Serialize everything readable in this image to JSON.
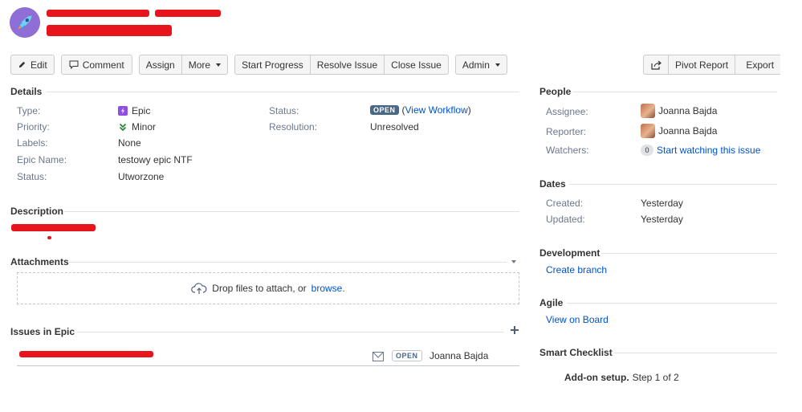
{
  "toolbar": {
    "edit": "Edit",
    "comment": "Comment",
    "assign": "Assign",
    "more": "More",
    "start_progress": "Start Progress",
    "resolve_issue": "Resolve Issue",
    "close_issue": "Close Issue",
    "admin": "Admin",
    "pivot_report": "Pivot Report",
    "export": "Export"
  },
  "details": {
    "title": "Details",
    "type_label": "Type:",
    "type_value": "Epic",
    "priority_label": "Priority:",
    "priority_value": "Minor",
    "labels_label": "Labels:",
    "labels_value": "None",
    "epic_name_label": "Epic Name:",
    "epic_name_value": "testowy epic NTF",
    "epic_status_label": "Status:",
    "epic_status_value": "Utworzone",
    "status_label": "Status:",
    "status_value": "OPEN",
    "view_workflow": "View Workflow",
    "resolution_label": "Resolution:",
    "resolution_value": "Unresolved"
  },
  "description": {
    "title": "Description"
  },
  "attachments": {
    "title": "Attachments",
    "drop_text": "Drop files to attach, or",
    "browse": "browse."
  },
  "issues_in_epic": {
    "title": "Issues in Epic",
    "rows": [
      {
        "status": "OPEN",
        "assignee": "Joanna Bajda"
      }
    ]
  },
  "people": {
    "title": "People",
    "assignee_label": "Assignee:",
    "assignee_value": "Joanna Bajda",
    "reporter_label": "Reporter:",
    "reporter_value": "Joanna Bajda",
    "watchers_label": "Watchers:",
    "watchers_count": "0",
    "watch_link": "Start watching this issue"
  },
  "dates": {
    "title": "Dates",
    "created_label": "Created:",
    "created_value": "Yesterday",
    "updated_label": "Updated:",
    "updated_value": "Yesterday"
  },
  "development": {
    "title": "Development",
    "create_branch": "Create branch"
  },
  "agile": {
    "title": "Agile",
    "view_on_board": "View on Board"
  },
  "smart_checklist": {
    "title": "Smart Checklist",
    "addon_setup": "Add-on setup.",
    "step": "Step 1 of 2"
  },
  "colors": {
    "link": "#0052cc",
    "epic": "#904ee2",
    "priority": "#2a8735",
    "redaction": "#e8141b"
  }
}
